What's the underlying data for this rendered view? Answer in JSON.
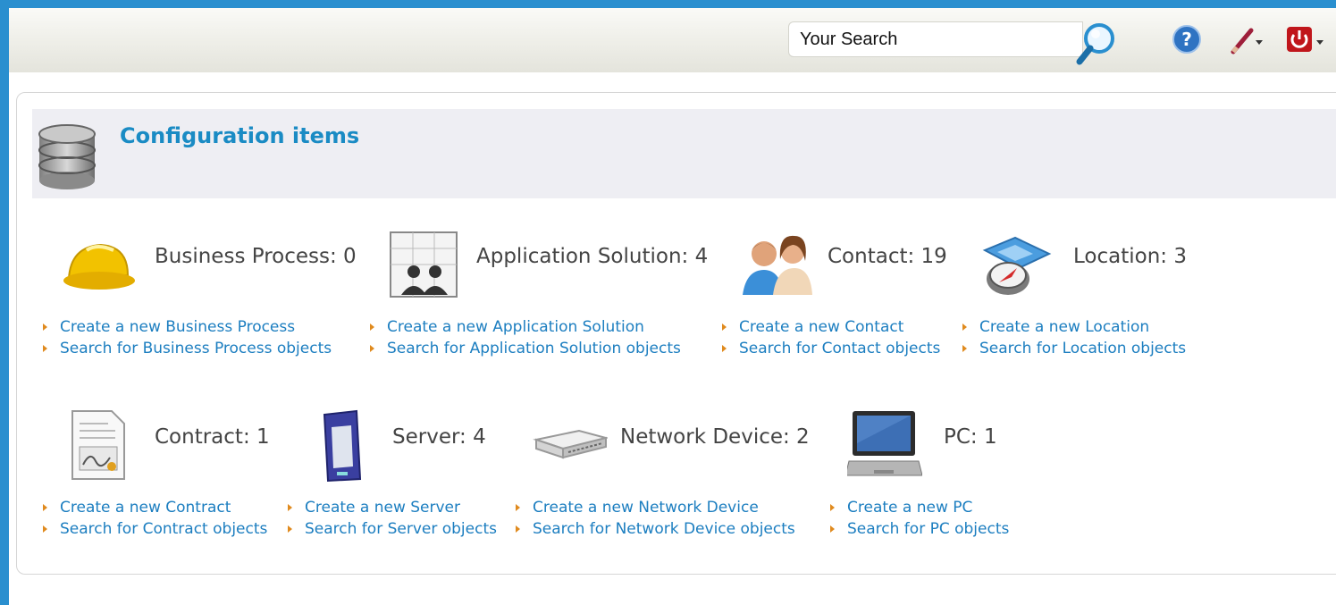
{
  "topbar": {
    "search_placeholder": "Your Search",
    "icons": [
      "search-icon",
      "help-icon",
      "edit-menu-icon",
      "logoff-menu-icon"
    ]
  },
  "dashlet": {
    "title": "Configuration items",
    "icon": "database-icon"
  },
  "items": [
    {
      "label": "Business Process: 0",
      "icon": "hard-hat-icon",
      "create": "Create a new Business Process",
      "search": "Search for Business Process objects"
    },
    {
      "label": "Application Solution: 4",
      "icon": "application-solution-icon",
      "create": "Create a new Application Solution",
      "search": "Search for Application Solution objects"
    },
    {
      "label": "Contact: 19",
      "icon": "contacts-icon",
      "create": "Create a new Contact",
      "search": "Search for Contact objects"
    },
    {
      "label": "Location: 3",
      "icon": "map-compass-icon",
      "create": "Create a new Location",
      "search": "Search for Location objects"
    },
    {
      "label": "Contract: 1",
      "icon": "contract-document-icon",
      "create": "Create a new Contract",
      "search": "Search for Contract objects"
    },
    {
      "label": "Server: 4",
      "icon": "server-icon",
      "create": "Create a new Server",
      "search": "Search for Server objects"
    },
    {
      "label": "Network Device: 2",
      "icon": "network-switch-icon",
      "create": "Create a new Network Device",
      "search": "Search for Network Device objects"
    },
    {
      "label": "PC: 1",
      "icon": "laptop-icon",
      "create": "Create a new PC",
      "search": "Search for PC objects"
    }
  ],
  "colors": {
    "frame": "#2a8fcf",
    "title": "#1a8bc4",
    "link": "#1c7ec0",
    "bullet": "#e08a1e"
  }
}
